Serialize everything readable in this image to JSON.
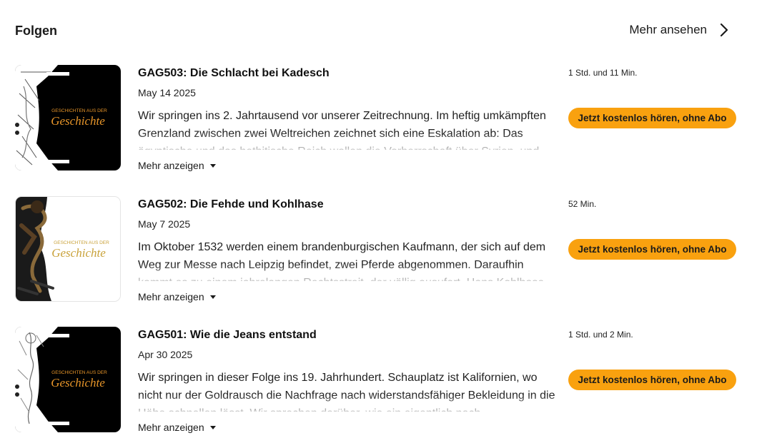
{
  "section": {
    "title": "Folgen",
    "see_more_label": "Mehr ansehen"
  },
  "episodes": [
    {
      "title": "GAG503: Die Schlacht bei Kadesch",
      "date": "May 14 2025",
      "description": "Wir springen ins 2. Jahrtausend vor unserer Zeitrechnung. Im heftig umkämpften Grenzland zwischen zwei Weltreichen zeichnet sich eine Eskalation ab: Das ägyptische und das hethitische Reich wollen die Vorherrschaft über Syrien, und",
      "more_label": "Mehr anzeigen",
      "duration": "1 Std. und 11 Min.",
      "cta_label": "Jetzt kostenlos hören, ohne Abo",
      "cover": {
        "theme": "dark",
        "brand_top": "GESCHICHTEN AUS DER",
        "brand_main": "Geschichte",
        "accent": "#e8962a"
      }
    },
    {
      "title": "GAG502: Die Fehde und Kohlhase",
      "date": "May 7 2025",
      "description": "Im Oktober 1532 werden einem brandenburgischen Kaufmann, der sich auf dem Weg zur Messe nach Leipzig befindet, zwei Pferde abgenommen. Daraufhin kommt es zu einem jahrelangen Rechtsstreit, der völlig ausufert. Hans Kohlhase",
      "more_label": "Mehr anzeigen",
      "duration": "52 Min.",
      "cta_label": "Jetzt kostenlos hören, ohne Abo",
      "cover": {
        "theme": "light",
        "brand_top": "GESCHICHTEN AUS DER",
        "brand_main": "Geschichte",
        "accent": "#c9a23a"
      }
    },
    {
      "title": "GAG501: Wie die Jeans entstand",
      "date": "Apr 30 2025",
      "description": "Wir springen in dieser Folge ins 19. Jahrhundert. Schauplatz ist Kalifornien, wo nicht nur der Goldrausch die Nachfrage nach widerstandsfähiger Bekleidung in die Höhe schnellen lässt. Wir sprechen darüber, wie ein eigentlich nach",
      "more_label": "Mehr anzeigen",
      "duration": "1 Std. und 2 Min.",
      "cta_label": "Jetzt kostenlos hören, ohne Abo",
      "cover": {
        "theme": "dark",
        "brand_top": "GESCHICHTEN AUS DER",
        "brand_main": "Geschichte",
        "accent": "#e8962a"
      }
    }
  ],
  "colors": {
    "cta": "#f9a10f",
    "text": "#1c1c1c"
  },
  "icons": {
    "see_more": "chevron-right-icon",
    "more": "caret-down-icon"
  }
}
